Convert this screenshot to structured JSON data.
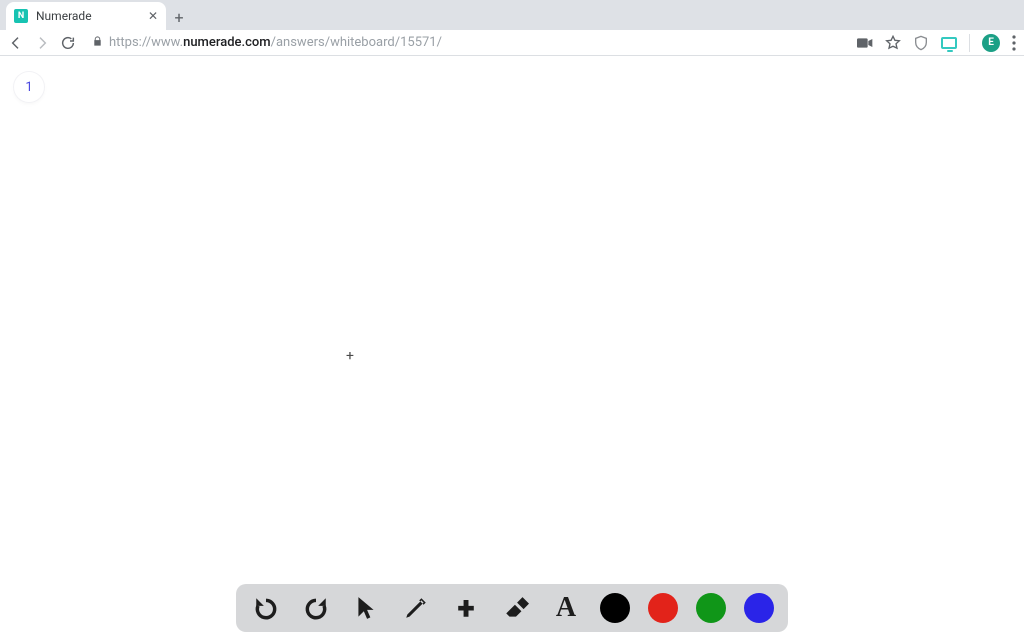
{
  "browser": {
    "tab": {
      "title": "Numerade",
      "favicon_letter": "N"
    },
    "url": {
      "scheme": "https://",
      "host_prefix": "www.",
      "host": "numerade.com",
      "path": "/answers/whiteboard/15571/"
    },
    "avatar_letter": "E"
  },
  "whiteboard": {
    "page_number": "1",
    "toolbar": {
      "undo": "Undo",
      "redo": "Redo",
      "pointer": "Pointer",
      "pen": "Pen",
      "add": "Add",
      "eraser": "Eraser",
      "text": "Text"
    },
    "colors": {
      "black": "#000000",
      "red": "#e2231a",
      "green": "#109618",
      "blue": "#2a24e8"
    },
    "text_tool_glyph": "A",
    "add_tool_glyph": "+",
    "crosshair_glyph": "+"
  }
}
